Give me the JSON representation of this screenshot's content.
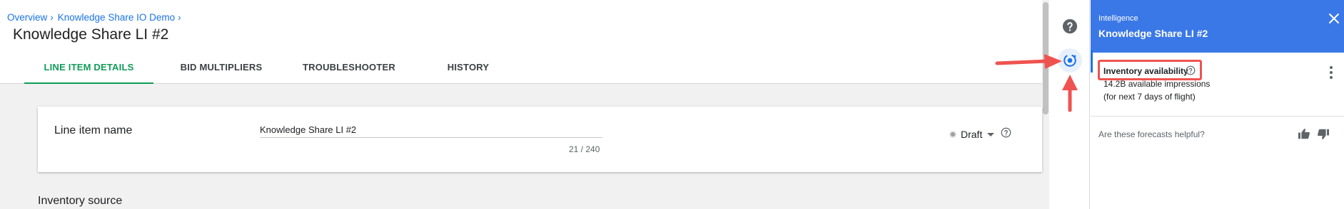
{
  "breadcrumb": {
    "items": [
      "Overview",
      "Knowledge Share IO Demo"
    ],
    "separator": "›"
  },
  "page": {
    "title": "Knowledge Share LI #2"
  },
  "tabs": [
    {
      "label": "LINE ITEM DETAILS",
      "active": true
    },
    {
      "label": "BID MULTIPLIERS",
      "active": false
    },
    {
      "label": "TROUBLESHOOTER",
      "active": false
    },
    {
      "label": "HISTORY",
      "active": false
    }
  ],
  "line_item": {
    "label": "Line item name",
    "name_value": "Knowledge Share LI #2",
    "char_count": "21 / 240",
    "status": "Draft"
  },
  "sections": {
    "inventory_source": "Inventory source"
  },
  "side_rail": {
    "help_icon": "help-circle-icon",
    "intelligence_icon": "intelligence-icon"
  },
  "intelligence": {
    "eyebrow": "Intelligence",
    "title": "Knowledge Share LI #2",
    "availability_heading": "Inventory availability",
    "availability_value": "14.2B available impressions",
    "availability_note": "(for next 7 days of flight)",
    "feedback_question": "Are these forecasts helpful?"
  },
  "colors": {
    "accent_green": "#0f9d58",
    "panel_header_blue": "#3b78e7",
    "link_blue": "#1a73e8",
    "annotation_red": "#ef5350"
  }
}
